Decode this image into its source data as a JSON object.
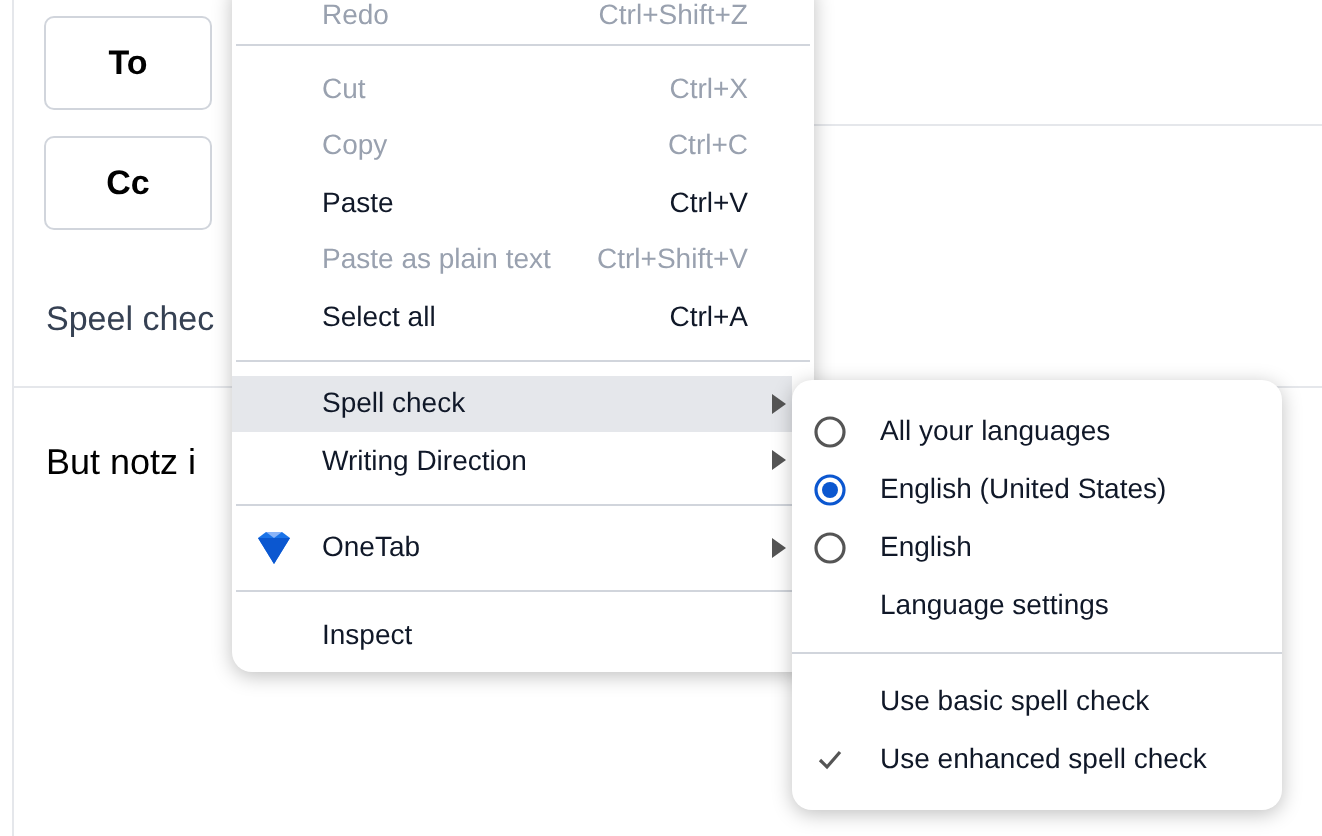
{
  "compose": {
    "buttons": [
      "To",
      "Cc"
    ],
    "subject_text": "Speel chec",
    "body_text": "But notz i"
  },
  "context_menu": {
    "items": [
      {
        "kind": "item",
        "label": "Redo",
        "shortcut": "Ctrl+Shift+Z",
        "disabled": true
      },
      {
        "kind": "separator"
      },
      {
        "kind": "item",
        "label": "Cut",
        "shortcut": "Ctrl+X",
        "disabled": true
      },
      {
        "kind": "item",
        "label": "Copy",
        "shortcut": "Ctrl+C",
        "disabled": true
      },
      {
        "kind": "item",
        "label": "Paste",
        "shortcut": "Ctrl+V",
        "disabled": false
      },
      {
        "kind": "item",
        "label": "Paste as plain text",
        "shortcut": "Ctrl+Shift+V",
        "disabled": true
      },
      {
        "kind": "item",
        "label": "Select all",
        "shortcut": "Ctrl+A",
        "disabled": false
      },
      {
        "kind": "separator"
      },
      {
        "kind": "submenu",
        "label": "Spell check",
        "highlighted": true
      },
      {
        "kind": "submenu",
        "label": "Writing Direction",
        "highlighted": false
      },
      {
        "kind": "separator"
      },
      {
        "kind": "submenu",
        "label": "OneTab",
        "highlighted": false,
        "has_icon": true
      },
      {
        "kind": "separator"
      },
      {
        "kind": "item",
        "label": "Inspect",
        "disabled": false
      }
    ]
  },
  "spell_check_submenu": {
    "items": [
      {
        "kind": "radio",
        "label": "All your languages",
        "selected": false
      },
      {
        "kind": "radio",
        "label": "English (United States)",
        "selected": true
      },
      {
        "kind": "radio",
        "label": "English",
        "selected": false
      },
      {
        "kind": "link",
        "label": "Language settings"
      },
      {
        "kind": "separator"
      },
      {
        "kind": "check",
        "label": "Use basic spell check",
        "checked": false
      },
      {
        "kind": "check",
        "label": "Use enhanced spell check",
        "checked": true
      }
    ]
  }
}
